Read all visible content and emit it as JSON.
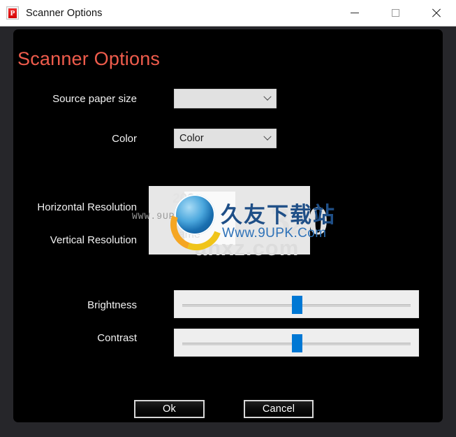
{
  "titlebar": {
    "title": "Scanner Options",
    "app_icon": "app-p-icon",
    "icon_letter": "P",
    "minimize_label": "minimize-icon",
    "maximize_label": "maximize-icon",
    "close_label": "close-icon"
  },
  "dialog": {
    "heading": "Scanner Options",
    "heading_color": "#ef5c4c",
    "background_color": "#000000",
    "accent_color": "#0078d4",
    "rows": {
      "source_paper_size": {
        "label": "Source paper size",
        "value": "",
        "placeholder": ""
      },
      "color": {
        "label": "Color",
        "value": "Color",
        "options": [
          "Color"
        ]
      },
      "horizontal_resolution": {
        "label": "Horizontal Resolution"
      },
      "vertical_resolution": {
        "label": "Vertical Resolution"
      },
      "brightness": {
        "label": "Brightness",
        "value": 50,
        "min": 0,
        "max": 100
      },
      "contrast": {
        "label": "Contrast",
        "value": 50,
        "min": 0,
        "max": 100
      }
    },
    "buttons": {
      "ok": "Ok",
      "cancel": "Cancel"
    }
  },
  "watermark": {
    "site_cn": "久友下载站",
    "site_url": "Www.9UPK.Com",
    "url_gray": "WWW.9UPK.COM",
    "bg_text": "anxz.com",
    "bg_number": "320",
    "small_200": "200",
    "small_same": "Same"
  }
}
